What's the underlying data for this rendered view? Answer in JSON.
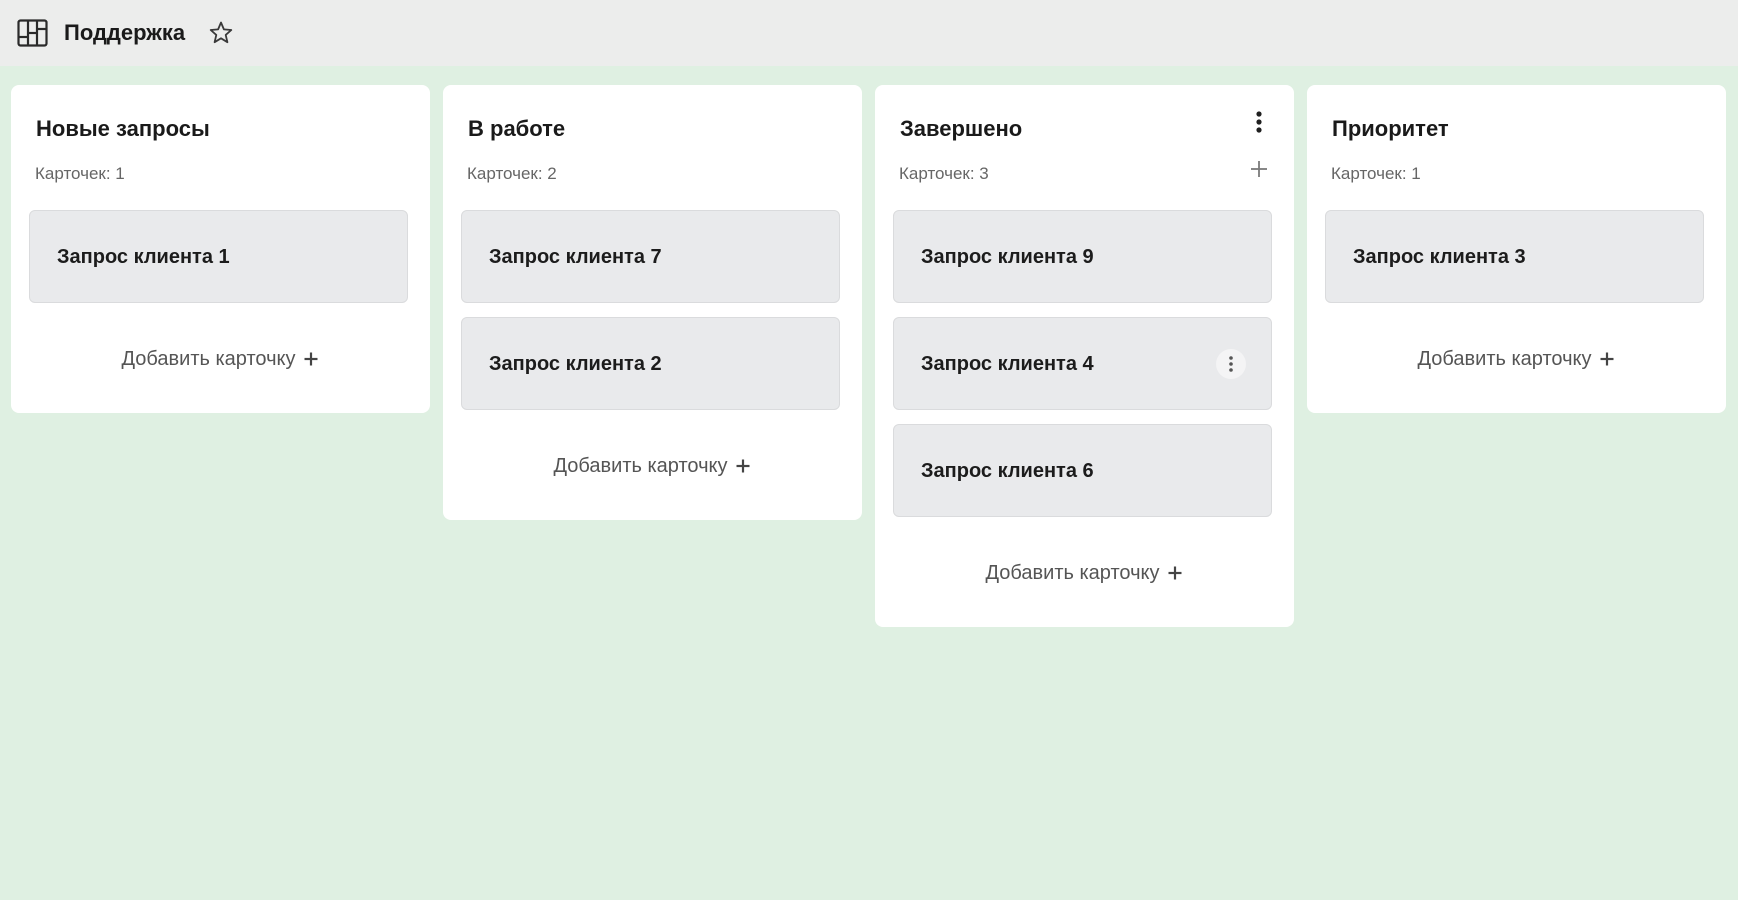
{
  "board": {
    "title": "Поддержка",
    "icon": "kanban-board-icon",
    "favorite_icon": "star-outline-icon"
  },
  "columns": [
    {
      "title": "Новые запросы",
      "count_label": "Карточек: 1",
      "cards": [
        "Запрос клиента 1"
      ],
      "add_label": "Добавить карточку"
    },
    {
      "title": "В работе",
      "count_label": "Карточек: 2",
      "cards": [
        "Запрос клиента 7",
        "Запрос клиента 2"
      ],
      "add_label": "Добавить карточку"
    },
    {
      "title": "Завершено",
      "count_label": "Карточек: 3",
      "cards": [
        "Запрос клиента 9",
        "Запрос клиента 4",
        "Запрос клиента 6"
      ],
      "add_label": "Добавить карточку"
    },
    {
      "title": "Приоритет",
      "count_label": "Карточек: 1",
      "cards": [
        "Запрос клиента 3"
      ],
      "add_label": "Добавить карточку"
    }
  ],
  "colors": {
    "background": "#dff0e2",
    "topbar": "#ecedec",
    "column": "#ffffff",
    "card": "#e9eaec"
  }
}
